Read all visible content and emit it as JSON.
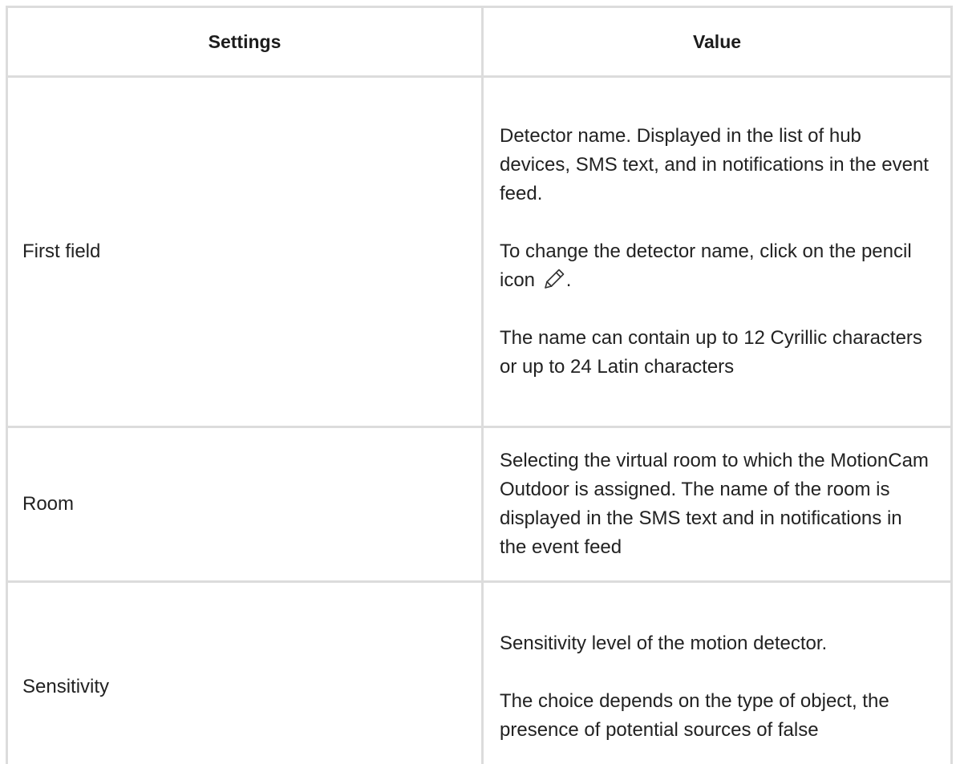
{
  "table": {
    "headers": {
      "settings": "Settings",
      "value": "Value"
    },
    "rows": [
      {
        "label": "First field",
        "paragraphs": [
          "Detector name. Displayed in the list of hub devices, SMS text, and in notifications in the event feed.",
          "To change the detector name, click on the pencil icon",
          "The name can contain up to 12 Cyrillic characters or up to 24 Latin characters"
        ],
        "pencil_suffix": ".",
        "icon": "pencil-icon"
      },
      {
        "label": "Room",
        "paragraphs": [
          "Selecting the virtual room to which the MotionCam Outdoor is assigned. The name of the room is displayed in the SMS text and in notifications in the event feed"
        ]
      },
      {
        "label": "Sensitivity",
        "paragraphs": [
          "Sensitivity level of the motion detector.",
          "The choice depends on the type of object, the presence of potential sources of false"
        ]
      }
    ]
  },
  "colors": {
    "border": "#dcdcdc",
    "text": "#222222",
    "background": "#ffffff"
  }
}
